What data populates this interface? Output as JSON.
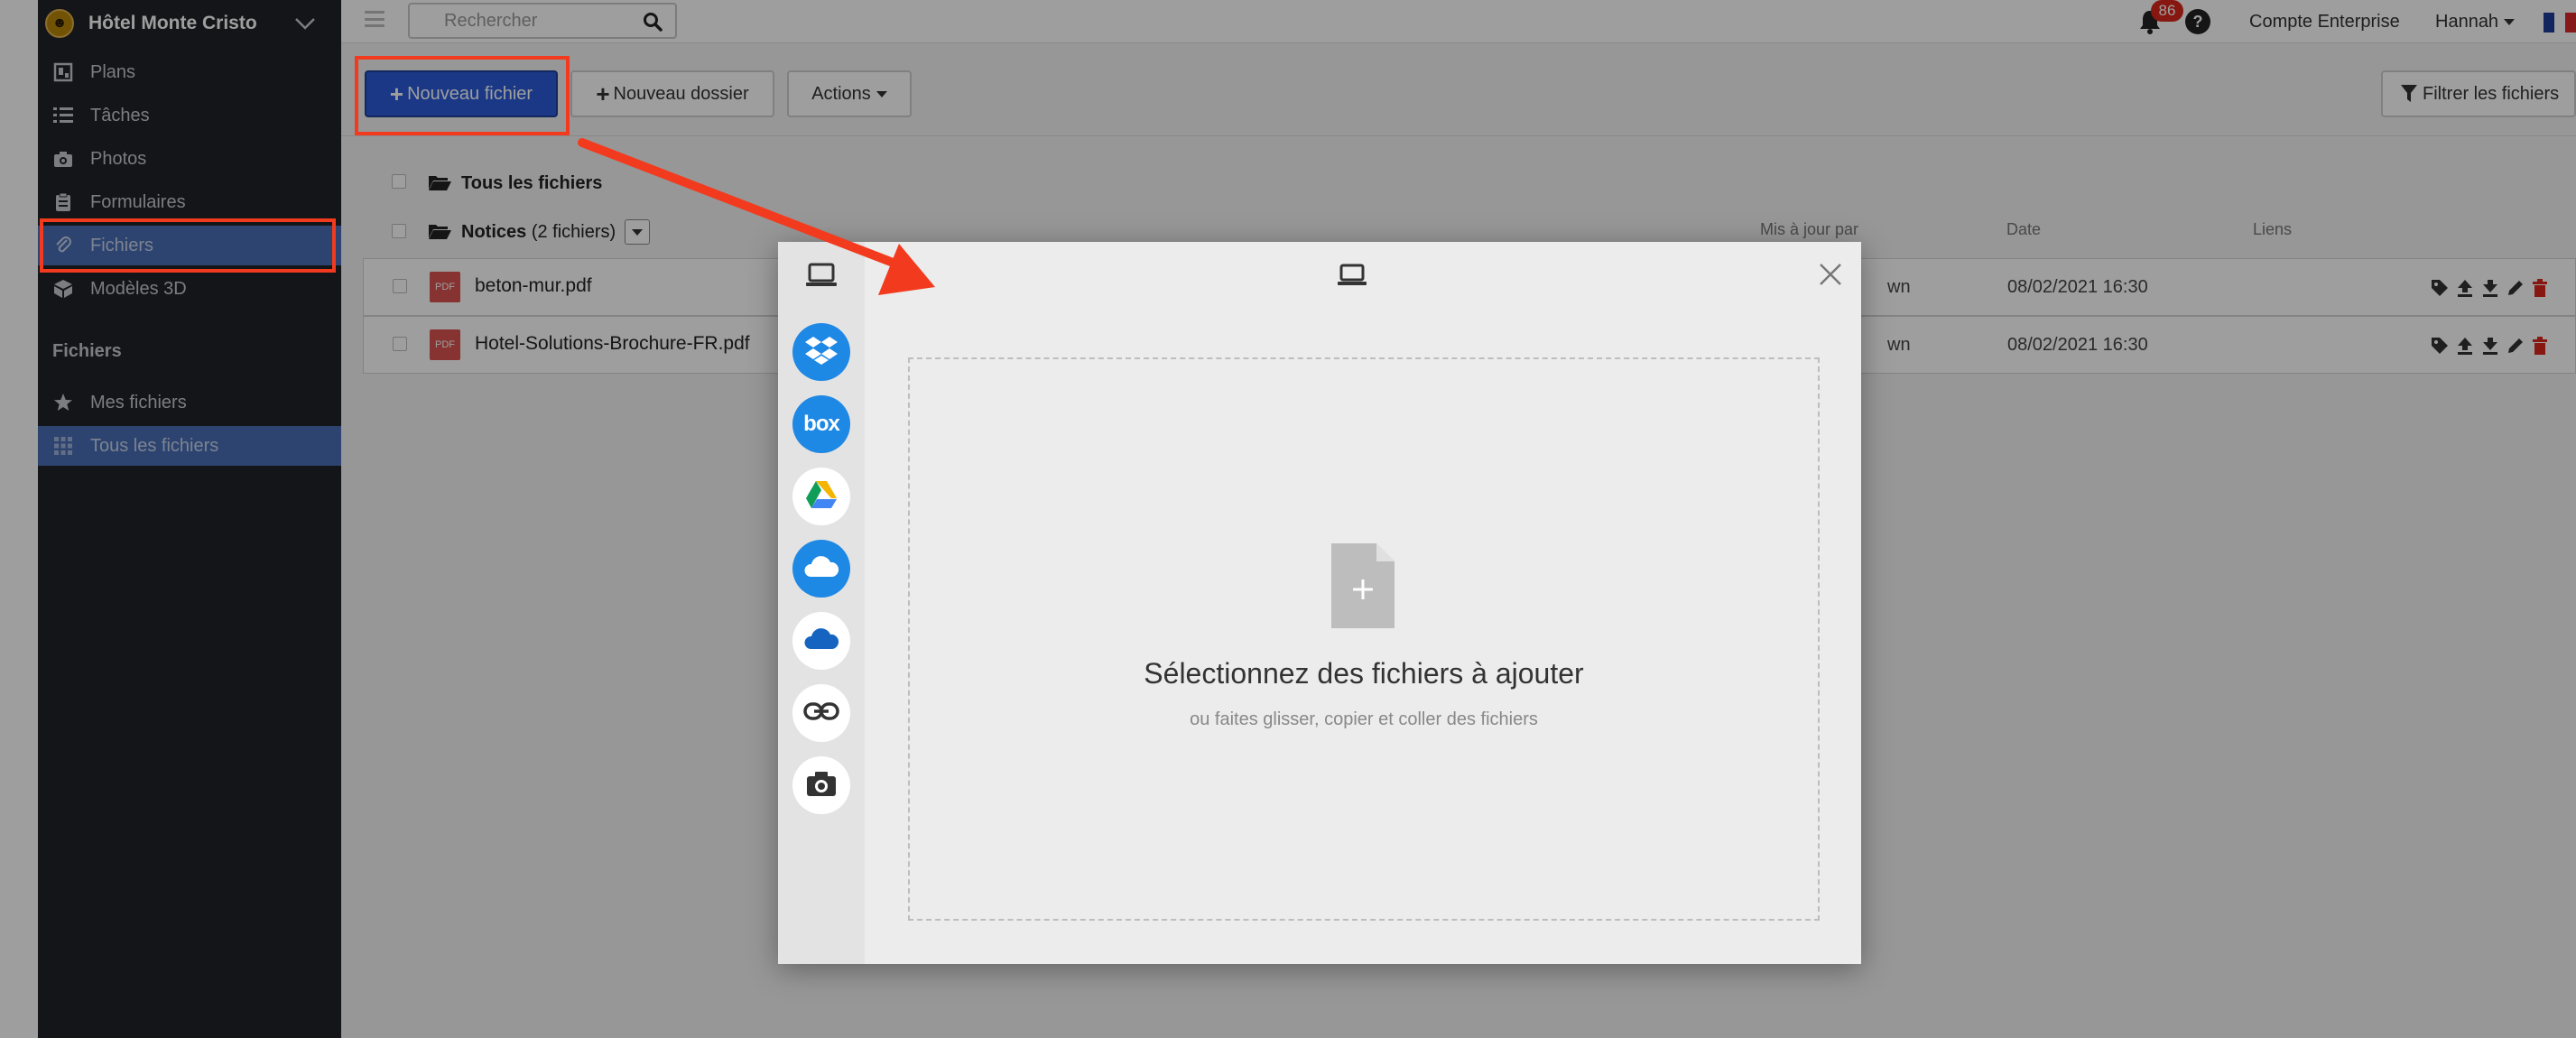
{
  "sidebar": {
    "hotel_name": "Hôtel Monte Cristo",
    "items": [
      {
        "label": "Plans",
        "icon": "floorplan-icon"
      },
      {
        "label": "Tâches",
        "icon": "list-icon"
      },
      {
        "label": "Photos",
        "icon": "camera-icon"
      },
      {
        "label": "Formulaires",
        "icon": "clipboard-icon"
      },
      {
        "label": "Fichiers",
        "icon": "paperclip-icon",
        "active": true
      },
      {
        "label": "Modèles 3D",
        "icon": "cube-icon"
      }
    ],
    "section_title": "Fichiers",
    "section_items": [
      {
        "label": "Mes fichiers",
        "icon": "star-icon"
      },
      {
        "label": "Tous les fichiers",
        "icon": "grid-icon",
        "active": true
      }
    ]
  },
  "topbar": {
    "search_placeholder": "Rechercher",
    "notification_count": "86",
    "help_label": "?",
    "account_label": "Compte Enterprise",
    "user_label": "Hannah",
    "language": "french-flag-icon"
  },
  "toolbar": {
    "new_file_label": "Nouveau fichier",
    "new_folder_label": "Nouveau dossier",
    "actions_label": "Actions",
    "filter_label": "Filtrer les fichiers"
  },
  "files": {
    "all_files_label": "Tous les fichiers",
    "folder_name": "Notices",
    "folder_count": "(2 fichiers)",
    "columns": {
      "updated_by": "Mis à jour par",
      "date": "Date",
      "links": "Liens"
    },
    "rows": [
      {
        "name": "beton-mur.pdf",
        "updated_by_partial": "wn",
        "date": "08/02/2021 16:30",
        "type_label": "PDF"
      },
      {
        "name": "Hotel-Solutions-Brochure-FR.pdf",
        "updated_by_partial": "wn",
        "date": "08/02/2021 16:30",
        "type_label": "PDF"
      }
    ]
  },
  "upload_modal": {
    "sources": [
      "my-device-icon",
      "dropbox-icon",
      "box-icon",
      "google-drive-icon",
      "onedrive-icon",
      "onedrive-business-icon",
      "link-icon",
      "camera-icon"
    ],
    "box_label": "box",
    "title": "Sélectionnez des fichiers à ajouter",
    "subtitle": "ou faites glisser, copier et coller des fichiers"
  },
  "colors": {
    "sidebar_bg": "#1f2227",
    "active_item": "#4a6fb5",
    "primary_button": "#2a5bd7",
    "annotation_red": "#f23b1e",
    "badge_red": "#d9261c"
  }
}
